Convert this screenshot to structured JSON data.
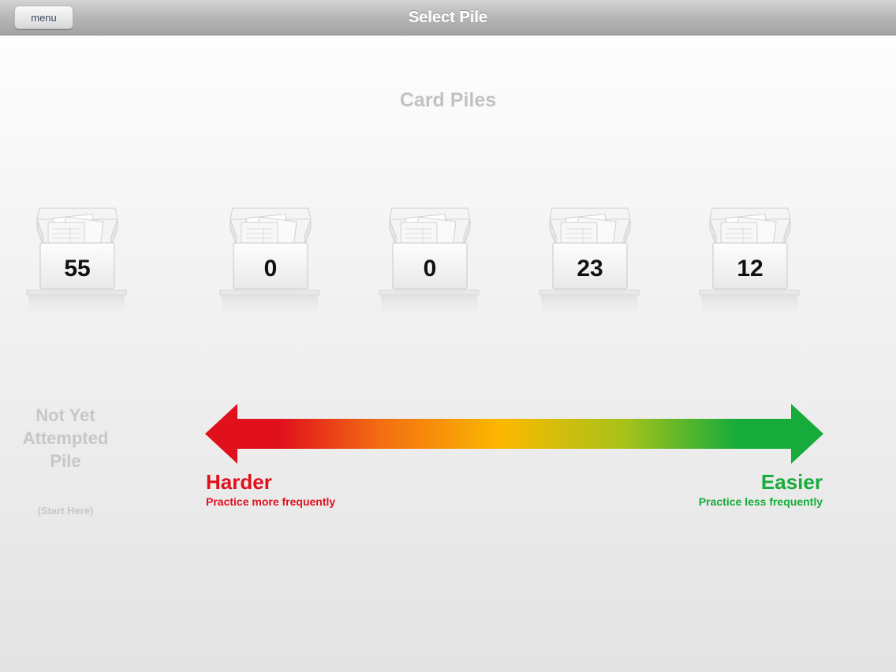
{
  "navbar": {
    "title": "Select Pile",
    "menu_label": "menu"
  },
  "main": {
    "title": "Card Piles",
    "piles": [
      {
        "count": "55",
        "icon": "card-box-icon"
      },
      {
        "count": "0",
        "icon": "card-box-icon"
      },
      {
        "count": "0",
        "icon": "card-box-icon"
      },
      {
        "count": "23",
        "icon": "card-box-icon"
      },
      {
        "count": "12",
        "icon": "card-box-icon"
      }
    ],
    "not_yet": {
      "label_line1": "Not Yet",
      "label_line2": "Attempted",
      "label_line3": "Pile",
      "hint": "(Start Here)"
    },
    "scale": {
      "harder_label": "Harder",
      "harder_sub": "Practice more frequently",
      "easier_label": "Easier",
      "easier_sub": "Practice less frequently",
      "colors": {
        "harder": "#e0101c",
        "middle": "#fbb900",
        "easier": "#16ab3a"
      }
    }
  }
}
